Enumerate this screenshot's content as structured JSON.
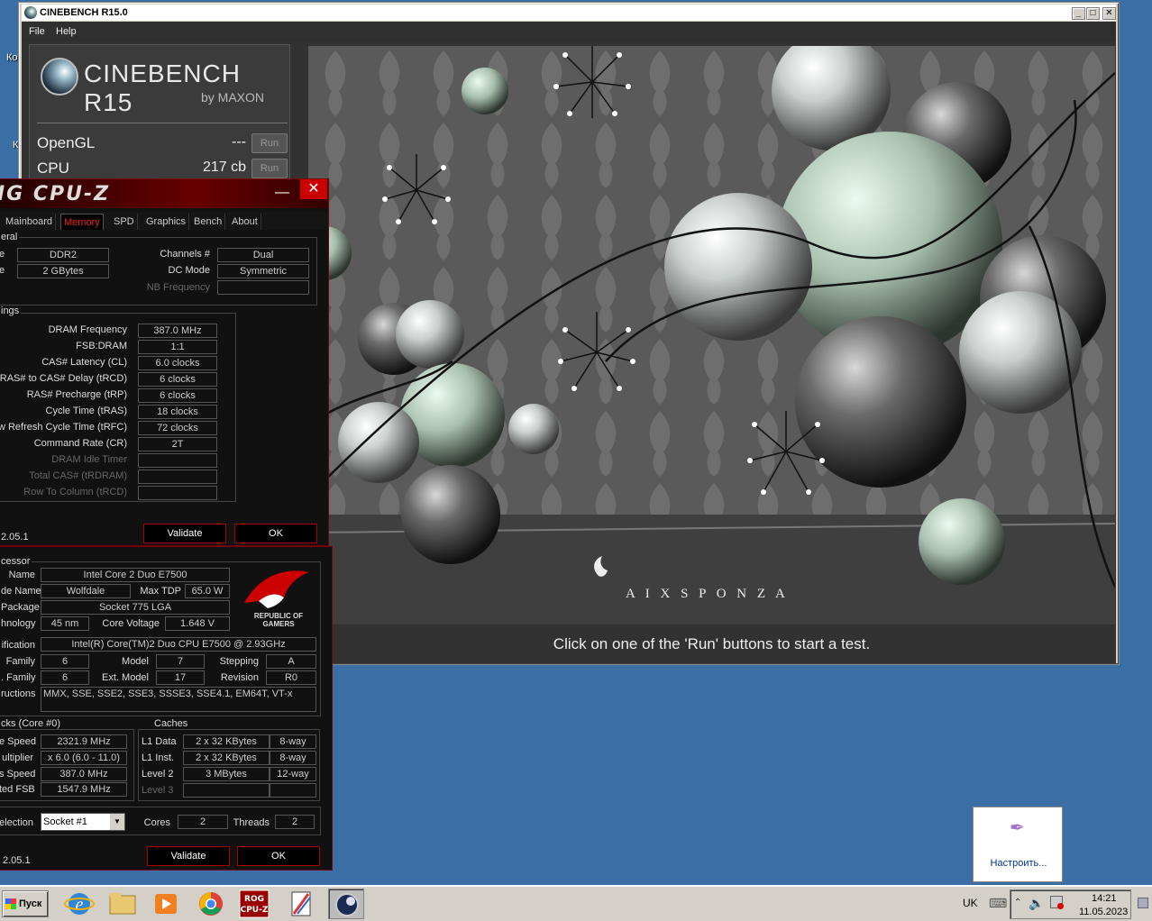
{
  "desktop": {
    "label_a": "Ко",
    "label_b": "К"
  },
  "cinebench": {
    "window_title": "CINEBENCH R15.0",
    "menu": {
      "file": "File",
      "help": "Help"
    },
    "logo_title": "CINEBENCH R15",
    "logo_sub": "by MAXON",
    "tests": [
      {
        "label": "OpenGL",
        "score": "---",
        "run_label": "Run"
      },
      {
        "label": "CPU",
        "score": "217 cb",
        "run_label": "Run"
      }
    ],
    "status": "Click on one of the 'Run' buttons to start a test.",
    "render_watermark": "A I X S P O N Z A"
  },
  "cpuz_memory": {
    "title": "IG CPU-Z",
    "tabs": [
      "Mainboard",
      "Memory",
      "SPD",
      "Graphics",
      "Bench",
      "About"
    ],
    "active_tab": "Memory",
    "general_group": "eral",
    "type_label": "e",
    "type_value": "DDR2",
    "size_label": "e",
    "size_value": "2 GBytes",
    "channels_label": "Channels #",
    "channels_value": "Dual",
    "dcmode_label": "DC Mode",
    "dcmode_value": "Symmetric",
    "nbfreq_label": "NB Frequency",
    "nbfreq_value": "",
    "timings_group": "ings",
    "timings": [
      {
        "label": "DRAM Frequency",
        "value": "387.0 MHz",
        "dim": false
      },
      {
        "label": "FSB:DRAM",
        "value": "1:1",
        "dim": false
      },
      {
        "label": "CAS# Latency (CL)",
        "value": "6.0 clocks",
        "dim": false
      },
      {
        "label": "RAS# to CAS# Delay (tRCD)",
        "value": "6 clocks",
        "dim": false
      },
      {
        "label": "RAS# Precharge (tRP)",
        "value": "6 clocks",
        "dim": false
      },
      {
        "label": "Cycle Time (tRAS)",
        "value": "18 clocks",
        "dim": false
      },
      {
        "label": "w Refresh Cycle Time (tRFC)",
        "value": "72 clocks",
        "dim": false
      },
      {
        "label": "Command Rate (CR)",
        "value": "2T",
        "dim": false
      },
      {
        "label": "DRAM Idle Timer",
        "value": "",
        "dim": true
      },
      {
        "label": "Total CAS# (tRDRAM)",
        "value": "",
        "dim": true
      },
      {
        "label": "Row To Column (tRCD)",
        "value": "",
        "dim": true
      }
    ],
    "version": "2.05.1",
    "validate_label": "Validate",
    "ok_label": "OK"
  },
  "cpuz_cpu": {
    "processor_group": "cessor",
    "name_label": "Name",
    "name_value": "Intel Core 2 Duo E7500",
    "codename_label": "de Name",
    "codename_value": "Wolfdale",
    "maxtdp_label": "Max TDP",
    "maxtdp_value": "65.0 W",
    "package_label": "Package",
    "package_value": "Socket 775 LGA",
    "tech_label": "hnology",
    "tech_value": "45 nm",
    "voltage_label": "Core Voltage",
    "voltage_value": "1.648 V",
    "spec_label": "ification",
    "spec_value": "Intel(R) Core(TM)2 Duo CPU     E7500  @ 2.93GHz",
    "family_label": "Family",
    "family_value": "6",
    "model_label": "Model",
    "model_value": "7",
    "stepping_label": "Stepping",
    "stepping_value": "A",
    "extfamily_label": ". Family",
    "extfamily_value": "6",
    "extmodel_label": "Ext. Model",
    "extmodel_value": "17",
    "revision_label": "Revision",
    "revision_value": "R0",
    "instr_label": "ructions",
    "instr_value": "MMX, SSE, SSE2, SSE3, SSSE3, SSE4.1, EM64T, VT-x",
    "rog_text_1": "REPUBLIC OF",
    "rog_text_2": "GAMERS",
    "clocks_group": "cks (Core #0)",
    "corespeed_label": "e Speed",
    "corespeed_value": "2321.9 MHz",
    "multiplier_label": "ultiplier",
    "multiplier_value": "x 6.0 (6.0 - 11.0)",
    "busspeed_label": "s Speed",
    "busspeed_value": "387.0 MHz",
    "ratedfsb_label": "ted FSB",
    "ratedfsb_value": "1547.9 MHz",
    "caches_group": "Caches",
    "caches": [
      {
        "label": "L1 Data",
        "size": "2 x 32 KBytes",
        "way": "8-way",
        "dim": false
      },
      {
        "label": "L1 Inst.",
        "size": "2 x 32 KBytes",
        "way": "8-way",
        "dim": false
      },
      {
        "label": "Level 2",
        "size": "3 MBytes",
        "way": "12-way",
        "dim": false
      },
      {
        "label": "Level 3",
        "size": "",
        "way": "",
        "dim": true
      }
    ],
    "selection_label": "election",
    "selection_value": "Socket #1",
    "cores_label": "Cores",
    "cores_value": "2",
    "threads_label": "Threads",
    "threads_value": "2",
    "version": "2.05.1",
    "validate_label": "Validate",
    "ok_label": "OK"
  },
  "notification": {
    "label": "Настроить..."
  },
  "taskbar": {
    "start_label": "Пуск",
    "lang": "UK",
    "time": "14:21",
    "date": "11.05.2023",
    "icons": [
      "ie-icon",
      "explorer-icon",
      "media-player-icon",
      "chrome-icon",
      "cpuz-icon",
      "paint-icon",
      "cinebench-icon"
    ]
  }
}
